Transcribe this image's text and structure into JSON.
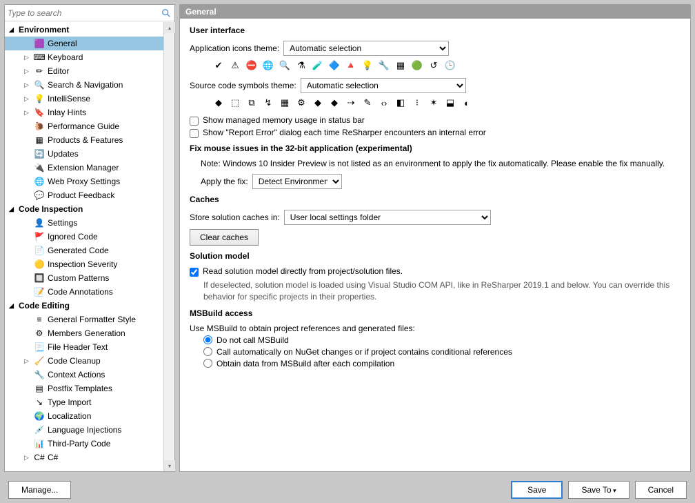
{
  "search": {
    "placeholder": "Type to search"
  },
  "content_header": "General",
  "tree": {
    "groups": [
      {
        "label": "Environment",
        "items": [
          {
            "label": "General",
            "icon": "app-icon",
            "selected": true
          },
          {
            "label": "Keyboard",
            "icon": "keyboard-icon",
            "expandable": true
          },
          {
            "label": "Editor",
            "icon": "pencil-icon",
            "expandable": true
          },
          {
            "label": "Search & Navigation",
            "icon": "magnifier-icon",
            "expandable": true
          },
          {
            "label": "IntelliSense",
            "icon": "bulb-icon",
            "expandable": true
          },
          {
            "label": "Inlay Hints",
            "icon": "tag-icon",
            "expandable": true
          },
          {
            "label": "Performance Guide",
            "icon": "gauge-icon"
          },
          {
            "label": "Products & Features",
            "icon": "grid-icon"
          },
          {
            "label": "Updates",
            "icon": "update-icon"
          },
          {
            "label": "Extension Manager",
            "icon": "plug-icon"
          },
          {
            "label": "Web Proxy Settings",
            "icon": "globe-icon"
          },
          {
            "label": "Product Feedback",
            "icon": "feedback-icon"
          }
        ]
      },
      {
        "label": "Code Inspection",
        "items": [
          {
            "label": "Settings",
            "icon": "person-icon"
          },
          {
            "label": "Ignored Code",
            "icon": "flag-icon"
          },
          {
            "label": "Generated Code",
            "icon": "code-icon"
          },
          {
            "label": "Inspection Severity",
            "icon": "severity-icon"
          },
          {
            "label": "Custom Patterns",
            "icon": "pattern-icon"
          },
          {
            "label": "Code Annotations",
            "icon": "annot-icon"
          }
        ]
      },
      {
        "label": "Code Editing",
        "items": [
          {
            "label": "General Formatter Style",
            "icon": "format-icon"
          },
          {
            "label": "Members Generation",
            "icon": "gear-icon"
          },
          {
            "label": "File Header Text",
            "icon": "header-icon"
          },
          {
            "label": "Code Cleanup",
            "icon": "broom-icon",
            "expandable": true
          },
          {
            "label": "Context Actions",
            "icon": "wrench-icon"
          },
          {
            "label": "Postfix Templates",
            "icon": "postfix-icon"
          },
          {
            "label": "Type Import",
            "icon": "import-icon"
          },
          {
            "label": "Localization",
            "icon": "locale-icon"
          },
          {
            "label": "Language Injections",
            "icon": "inject-icon"
          },
          {
            "label": "Third-Party Code",
            "icon": "thirdparty-icon"
          },
          {
            "label": "C#",
            "icon": "csharp-icon",
            "expandable": true
          }
        ]
      }
    ]
  },
  "ui": {
    "section": "User interface",
    "app_icons_label": "Application icons theme:",
    "app_icons_value": "Automatic selection",
    "symbols_label": "Source code symbols theme:",
    "symbols_value": "Automatic selection",
    "chk_memory": "Show managed memory usage in status bar",
    "chk_report": "Show \"Report Error\" dialog each time ReSharper encounters an internal error"
  },
  "mouse": {
    "section": "Fix mouse issues in the 32-bit application (experimental)",
    "note": "Note: Windows 10 Insider Preview is not listed as an environment to apply the fix automatically. Please enable the fix manually.",
    "apply_label": "Apply the fix:",
    "apply_value": "Detect Environment"
  },
  "caches": {
    "section": "Caches",
    "store_label": "Store solution caches in:",
    "store_value": "User local settings folder",
    "clear_button": "Clear caches"
  },
  "solution": {
    "section": "Solution model",
    "chk": "Read solution model directly from project/solution files.",
    "hint": "If deselected, solution model is loaded using Visual Studio COM API, like in ReSharper 2019.1 and below. You can override this behavior for specific projects in their properties."
  },
  "msbuild": {
    "section": "MSBuild access",
    "intro": "Use MSBuild to obtain project references and generated files:",
    "opt1": "Do not call MSBuild",
    "opt2": "Call automatically on NuGet changes or if project contains conditional references",
    "opt3": "Obtain data from MSBuild after each compilation"
  },
  "footer": {
    "manage": "Manage...",
    "save": "Save",
    "save_to": "Save To",
    "cancel": "Cancel"
  },
  "icons": {
    "strip1": [
      "✔",
      "⚠",
      "⛔",
      "🌐",
      "🔍",
      "⚗",
      "🧪",
      "🔷",
      "🔺",
      "💡",
      "🔧",
      "▦",
      "🟢",
      "↺",
      "🕒"
    ],
    "strip2": [
      "◆",
      "⬚",
      "⧉",
      "↯",
      "▦",
      "⚙",
      "◆",
      "◆",
      "⇢",
      "✎",
      "‹›",
      "◧",
      "⁝",
      "✶",
      "⬓",
      "◐"
    ]
  }
}
